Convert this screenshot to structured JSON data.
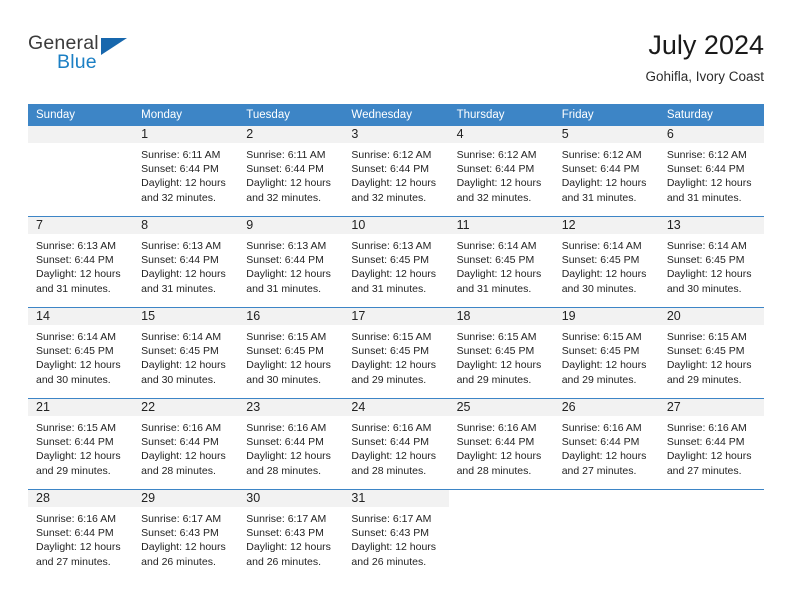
{
  "brand": {
    "name_part1": "General",
    "name_part2": "Blue",
    "triangle_color": "#1767ad",
    "blue_color": "#1b7fc4"
  },
  "header": {
    "title": "July 2024",
    "subtitle": "Gohifla, Ivory Coast"
  },
  "colors": {
    "header_band": "#3d85c6",
    "daynum_band": "#f2f2f2",
    "row_divider": "#3d85c6",
    "text": "#232323"
  },
  "calendar": {
    "weekday_headers": [
      "Sunday",
      "Monday",
      "Tuesday",
      "Wednesday",
      "Thursday",
      "Friday",
      "Saturday"
    ],
    "weeks": [
      [
        {
          "day": "",
          "sunrise": "",
          "sunset": "",
          "daylight_line1": "",
          "daylight_line2": "",
          "empty": true
        },
        {
          "day": "1",
          "sunrise": "Sunrise: 6:11 AM",
          "sunset": "Sunset: 6:44 PM",
          "daylight_line1": "Daylight: 12 hours",
          "daylight_line2": "and 32 minutes."
        },
        {
          "day": "2",
          "sunrise": "Sunrise: 6:11 AM",
          "sunset": "Sunset: 6:44 PM",
          "daylight_line1": "Daylight: 12 hours",
          "daylight_line2": "and 32 minutes."
        },
        {
          "day": "3",
          "sunrise": "Sunrise: 6:12 AM",
          "sunset": "Sunset: 6:44 PM",
          "daylight_line1": "Daylight: 12 hours",
          "daylight_line2": "and 32 minutes."
        },
        {
          "day": "4",
          "sunrise": "Sunrise: 6:12 AM",
          "sunset": "Sunset: 6:44 PM",
          "daylight_line1": "Daylight: 12 hours",
          "daylight_line2": "and 32 minutes."
        },
        {
          "day": "5",
          "sunrise": "Sunrise: 6:12 AM",
          "sunset": "Sunset: 6:44 PM",
          "daylight_line1": "Daylight: 12 hours",
          "daylight_line2": "and 31 minutes."
        },
        {
          "day": "6",
          "sunrise": "Sunrise: 6:12 AM",
          "sunset": "Sunset: 6:44 PM",
          "daylight_line1": "Daylight: 12 hours",
          "daylight_line2": "and 31 minutes."
        }
      ],
      [
        {
          "day": "7",
          "sunrise": "Sunrise: 6:13 AM",
          "sunset": "Sunset: 6:44 PM",
          "daylight_line1": "Daylight: 12 hours",
          "daylight_line2": "and 31 minutes."
        },
        {
          "day": "8",
          "sunrise": "Sunrise: 6:13 AM",
          "sunset": "Sunset: 6:44 PM",
          "daylight_line1": "Daylight: 12 hours",
          "daylight_line2": "and 31 minutes."
        },
        {
          "day": "9",
          "sunrise": "Sunrise: 6:13 AM",
          "sunset": "Sunset: 6:44 PM",
          "daylight_line1": "Daylight: 12 hours",
          "daylight_line2": "and 31 minutes."
        },
        {
          "day": "10",
          "sunrise": "Sunrise: 6:13 AM",
          "sunset": "Sunset: 6:45 PM",
          "daylight_line1": "Daylight: 12 hours",
          "daylight_line2": "and 31 minutes."
        },
        {
          "day": "11",
          "sunrise": "Sunrise: 6:14 AM",
          "sunset": "Sunset: 6:45 PM",
          "daylight_line1": "Daylight: 12 hours",
          "daylight_line2": "and 31 minutes."
        },
        {
          "day": "12",
          "sunrise": "Sunrise: 6:14 AM",
          "sunset": "Sunset: 6:45 PM",
          "daylight_line1": "Daylight: 12 hours",
          "daylight_line2": "and 30 minutes."
        },
        {
          "day": "13",
          "sunrise": "Sunrise: 6:14 AM",
          "sunset": "Sunset: 6:45 PM",
          "daylight_line1": "Daylight: 12 hours",
          "daylight_line2": "and 30 minutes."
        }
      ],
      [
        {
          "day": "14",
          "sunrise": "Sunrise: 6:14 AM",
          "sunset": "Sunset: 6:45 PM",
          "daylight_line1": "Daylight: 12 hours",
          "daylight_line2": "and 30 minutes."
        },
        {
          "day": "15",
          "sunrise": "Sunrise: 6:14 AM",
          "sunset": "Sunset: 6:45 PM",
          "daylight_line1": "Daylight: 12 hours",
          "daylight_line2": "and 30 minutes."
        },
        {
          "day": "16",
          "sunrise": "Sunrise: 6:15 AM",
          "sunset": "Sunset: 6:45 PM",
          "daylight_line1": "Daylight: 12 hours",
          "daylight_line2": "and 30 minutes."
        },
        {
          "day": "17",
          "sunrise": "Sunrise: 6:15 AM",
          "sunset": "Sunset: 6:45 PM",
          "daylight_line1": "Daylight: 12 hours",
          "daylight_line2": "and 29 minutes."
        },
        {
          "day": "18",
          "sunrise": "Sunrise: 6:15 AM",
          "sunset": "Sunset: 6:45 PM",
          "daylight_line1": "Daylight: 12 hours",
          "daylight_line2": "and 29 minutes."
        },
        {
          "day": "19",
          "sunrise": "Sunrise: 6:15 AM",
          "sunset": "Sunset: 6:45 PM",
          "daylight_line1": "Daylight: 12 hours",
          "daylight_line2": "and 29 minutes."
        },
        {
          "day": "20",
          "sunrise": "Sunrise: 6:15 AM",
          "sunset": "Sunset: 6:45 PM",
          "daylight_line1": "Daylight: 12 hours",
          "daylight_line2": "and 29 minutes."
        }
      ],
      [
        {
          "day": "21",
          "sunrise": "Sunrise: 6:15 AM",
          "sunset": "Sunset: 6:44 PM",
          "daylight_line1": "Daylight: 12 hours",
          "daylight_line2": "and 29 minutes."
        },
        {
          "day": "22",
          "sunrise": "Sunrise: 6:16 AM",
          "sunset": "Sunset: 6:44 PM",
          "daylight_line1": "Daylight: 12 hours",
          "daylight_line2": "and 28 minutes."
        },
        {
          "day": "23",
          "sunrise": "Sunrise: 6:16 AM",
          "sunset": "Sunset: 6:44 PM",
          "daylight_line1": "Daylight: 12 hours",
          "daylight_line2": "and 28 minutes."
        },
        {
          "day": "24",
          "sunrise": "Sunrise: 6:16 AM",
          "sunset": "Sunset: 6:44 PM",
          "daylight_line1": "Daylight: 12 hours",
          "daylight_line2": "and 28 minutes."
        },
        {
          "day": "25",
          "sunrise": "Sunrise: 6:16 AM",
          "sunset": "Sunset: 6:44 PM",
          "daylight_line1": "Daylight: 12 hours",
          "daylight_line2": "and 28 minutes."
        },
        {
          "day": "26",
          "sunrise": "Sunrise: 6:16 AM",
          "sunset": "Sunset: 6:44 PM",
          "daylight_line1": "Daylight: 12 hours",
          "daylight_line2": "and 27 minutes."
        },
        {
          "day": "27",
          "sunrise": "Sunrise: 6:16 AM",
          "sunset": "Sunset: 6:44 PM",
          "daylight_line1": "Daylight: 12 hours",
          "daylight_line2": "and 27 minutes."
        }
      ],
      [
        {
          "day": "28",
          "sunrise": "Sunrise: 6:16 AM",
          "sunset": "Sunset: 6:44 PM",
          "daylight_line1": "Daylight: 12 hours",
          "daylight_line2": "and 27 minutes."
        },
        {
          "day": "29",
          "sunrise": "Sunrise: 6:17 AM",
          "sunset": "Sunset: 6:43 PM",
          "daylight_line1": "Daylight: 12 hours",
          "daylight_line2": "and 26 minutes."
        },
        {
          "day": "30",
          "sunrise": "Sunrise: 6:17 AM",
          "sunset": "Sunset: 6:43 PM",
          "daylight_line1": "Daylight: 12 hours",
          "daylight_line2": "and 26 minutes."
        },
        {
          "day": "31",
          "sunrise": "Sunrise: 6:17 AM",
          "sunset": "Sunset: 6:43 PM",
          "daylight_line1": "Daylight: 12 hours",
          "daylight_line2": "and 26 minutes."
        },
        {
          "day": "",
          "sunrise": "",
          "sunset": "",
          "daylight_line1": "",
          "daylight_line2": "",
          "blank": true
        },
        {
          "day": "",
          "sunrise": "",
          "sunset": "",
          "daylight_line1": "",
          "daylight_line2": "",
          "blank": true
        },
        {
          "day": "",
          "sunrise": "",
          "sunset": "",
          "daylight_line1": "",
          "daylight_line2": "",
          "blank": true
        }
      ]
    ]
  }
}
